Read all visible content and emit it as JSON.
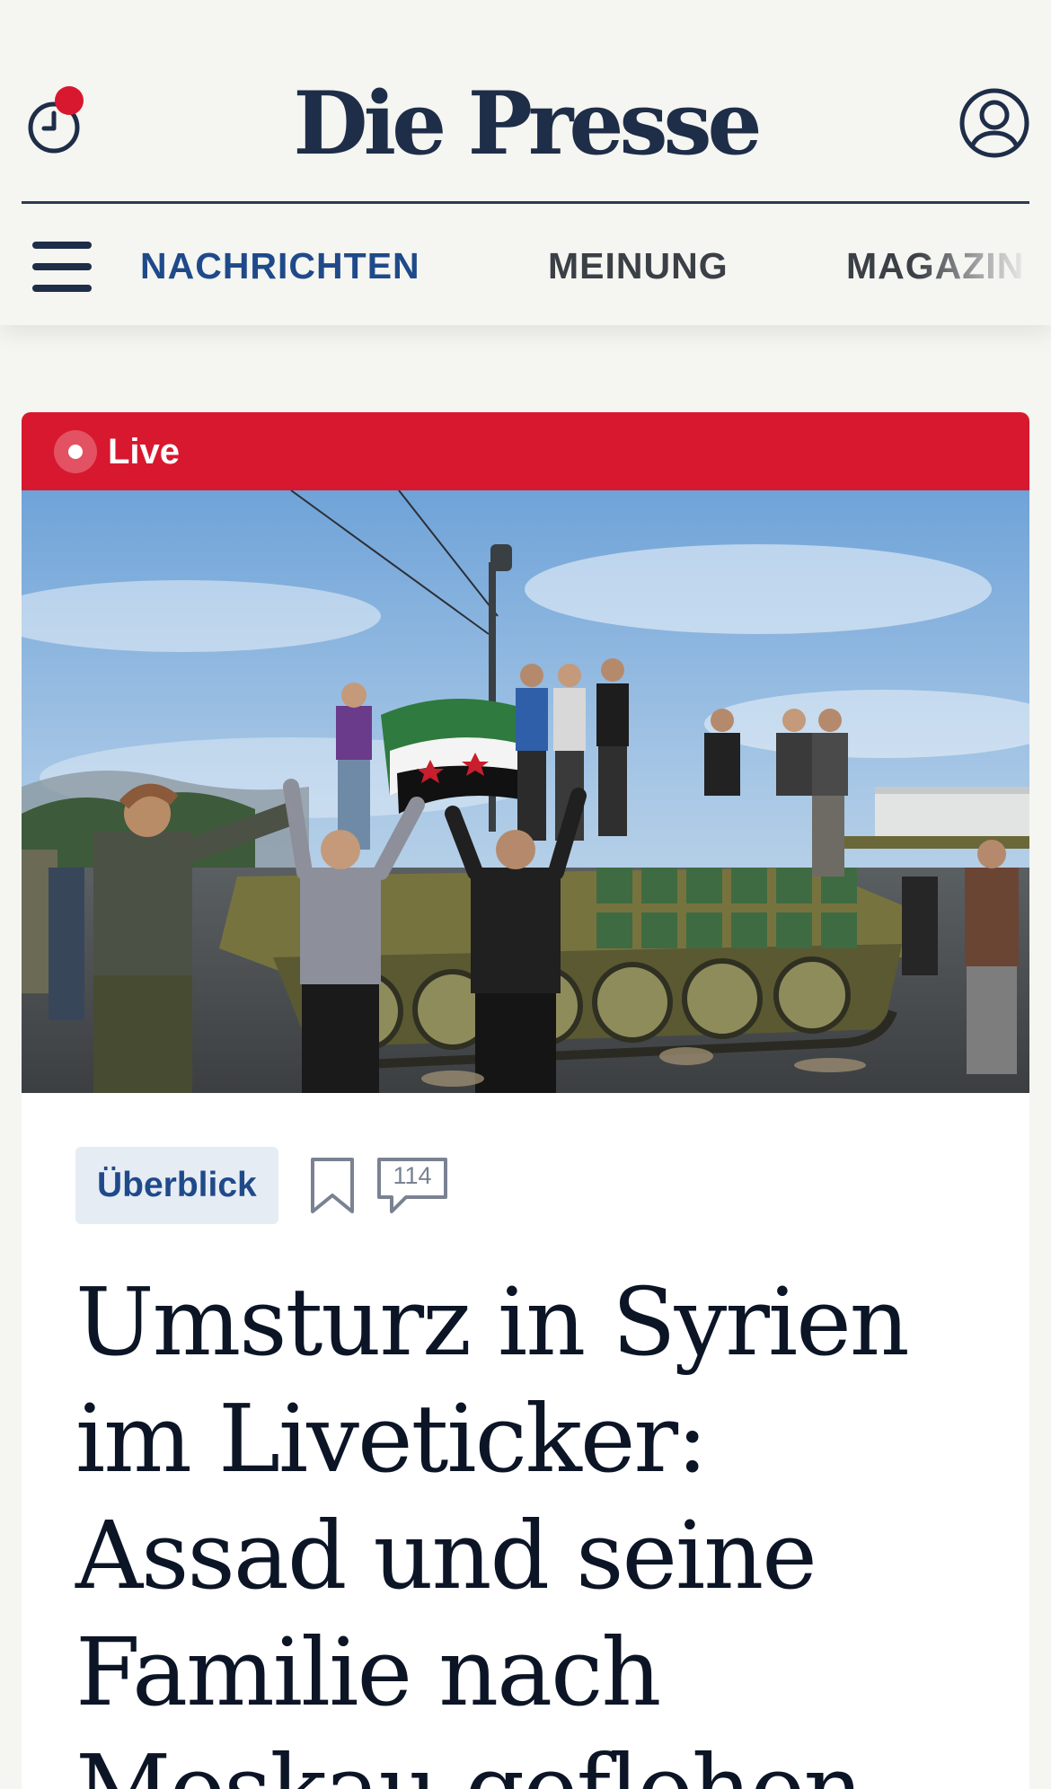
{
  "header": {
    "logo_text": "Die Presse",
    "history_icon": "clock-icon",
    "account_icon": "user-circle-icon",
    "notification_dot_color": "#d8182e"
  },
  "nav": {
    "menu_icon": "hamburger-icon",
    "items": [
      {
        "label": "NACHRICHTEN",
        "active": true
      },
      {
        "label": "MEINUNG",
        "active": false
      },
      {
        "label": "MAGAZIN",
        "active": false
      }
    ]
  },
  "article": {
    "live_label": "Live",
    "category": "Überblick",
    "comment_count": "114",
    "headline": "Umsturz in Syrien im Liveticker: Assad und seine Familie nach Moskau geflohen"
  },
  "colors": {
    "brand_navy": "#1e2d48",
    "accent_blue": "#1f4a8a",
    "live_red": "#d8182e",
    "page_background": "#f5f5f1"
  }
}
